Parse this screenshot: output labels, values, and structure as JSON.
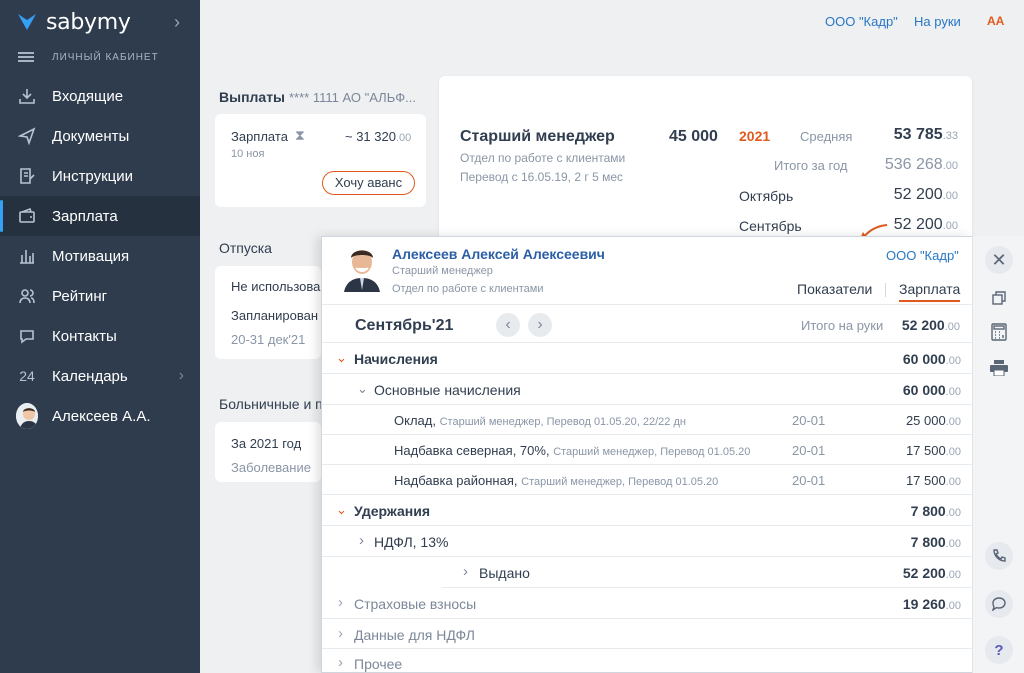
{
  "app": {
    "brand": "sabymy",
    "cabinet": "ЛИЧНЫЙ КАБИНЕТ"
  },
  "sidebar": {
    "items": [
      {
        "label": "Входящие",
        "icon": "inbox-icon"
      },
      {
        "label": "Документы",
        "icon": "send-icon"
      },
      {
        "label": "Инструкции",
        "icon": "edit-note-icon"
      },
      {
        "label": "Зарплата",
        "icon": "wallet-icon",
        "active": true
      },
      {
        "label": "Мотивация",
        "icon": "bar-chart-icon"
      },
      {
        "label": "Рейтинг",
        "icon": "people-icon"
      },
      {
        "label": "Контакты",
        "icon": "chat-icon"
      },
      {
        "label": "Календарь",
        "icon": "calendar-icon",
        "day": "24"
      },
      {
        "label": "Алексеев А.А.",
        "icon": "avatar"
      }
    ]
  },
  "topbar": {
    "company": "ООО \"Кадр\"",
    "net": "На руки",
    "font_toggle": "AA"
  },
  "payments": {
    "title": "Выплаты",
    "account": "**** 1111  АО \"АЛЬФ...",
    "salary_label": "Зарплата",
    "salary_date": "10 ноя",
    "salary_amount": "~ 31 320",
    "salary_dec": ".00",
    "advance_button": "Хочу аванс"
  },
  "vacations": {
    "title": "Отпуска",
    "unused": "Не использова",
    "planned": "Запланирован",
    "planned_dates": "20-31 дек'21"
  },
  "sick": {
    "title": "Больничные и п",
    "year": "За 2021 год",
    "status": "Заболевание"
  },
  "position_card": {
    "position": "Старший менеджер",
    "salary": "45 000",
    "department": "Отдел по работе с клиентами",
    "transfer": "Перевод с 16.05.19, 2 г 5 мес",
    "year": "2021",
    "avg_label": "Средняя",
    "avg_value": "53 785",
    "avg_dec": ".33",
    "total_label": "Итого за год",
    "total_value": "536 268",
    "total_dec": ".00",
    "m1_label": "Октябрь",
    "m1_value": "52 200",
    "m1_dec": ".00",
    "m2_label": "Сентябрь",
    "m2_value": "52 200",
    "m2_dec": ".00"
  },
  "popup": {
    "name": "Алексеев Алексей Алексеевич",
    "role": "Старший менеджер",
    "department": "Отдел по работе с клиентами",
    "company": "ООО \"Кадр\"",
    "tab_metrics": "Показатели",
    "tab_salary": "Зарплата",
    "period": "Сентябрь'21",
    "net_label": "Итого на руки",
    "net_value": "52 200",
    "net_dec": ".00",
    "rows": {
      "accruals": {
        "label": "Начисления",
        "value": "60 000",
        "dec": ".00"
      },
      "main_accruals": {
        "label": "Основные начисления",
        "value": "60 000",
        "dec": ".00"
      },
      "salary": {
        "label": "Оклад,",
        "detail": "Старший менеджер, Перевод 01.05.20, 22/22 дн",
        "code": "20-01",
        "value": "25 000",
        "dec": ".00"
      },
      "north": {
        "label": "Надбавка северная, 70%,",
        "detail": "Старший менеджер, Перевод 01.05.20",
        "code": "20-01",
        "value": "17 500",
        "dec": ".00"
      },
      "regional": {
        "label": "Надбавка районная,",
        "detail": "Старший менеджер, Перевод 01.05.20",
        "code": "20-01",
        "value": "17 500",
        "dec": ".00"
      },
      "deductions": {
        "label": "Удержания",
        "value": "7 800",
        "dec": ".00"
      },
      "ndfl": {
        "label": "НДФЛ, 13%",
        "value": "7 800",
        "dec": ".00"
      },
      "issued": {
        "label": "Выдано",
        "value": "52 200",
        "dec": ".00"
      },
      "insurance": {
        "label": "Страховые взносы",
        "value": "19 260",
        "dec": ".00"
      },
      "ndfl_data": {
        "label": "Данные для НДФЛ"
      },
      "other": {
        "label": "Прочее"
      }
    }
  },
  "colors": {
    "sidebar": "#2f3c4e",
    "accent": "#e05a1e",
    "link": "#2877c6",
    "active_bar": "#36a0f5"
  }
}
